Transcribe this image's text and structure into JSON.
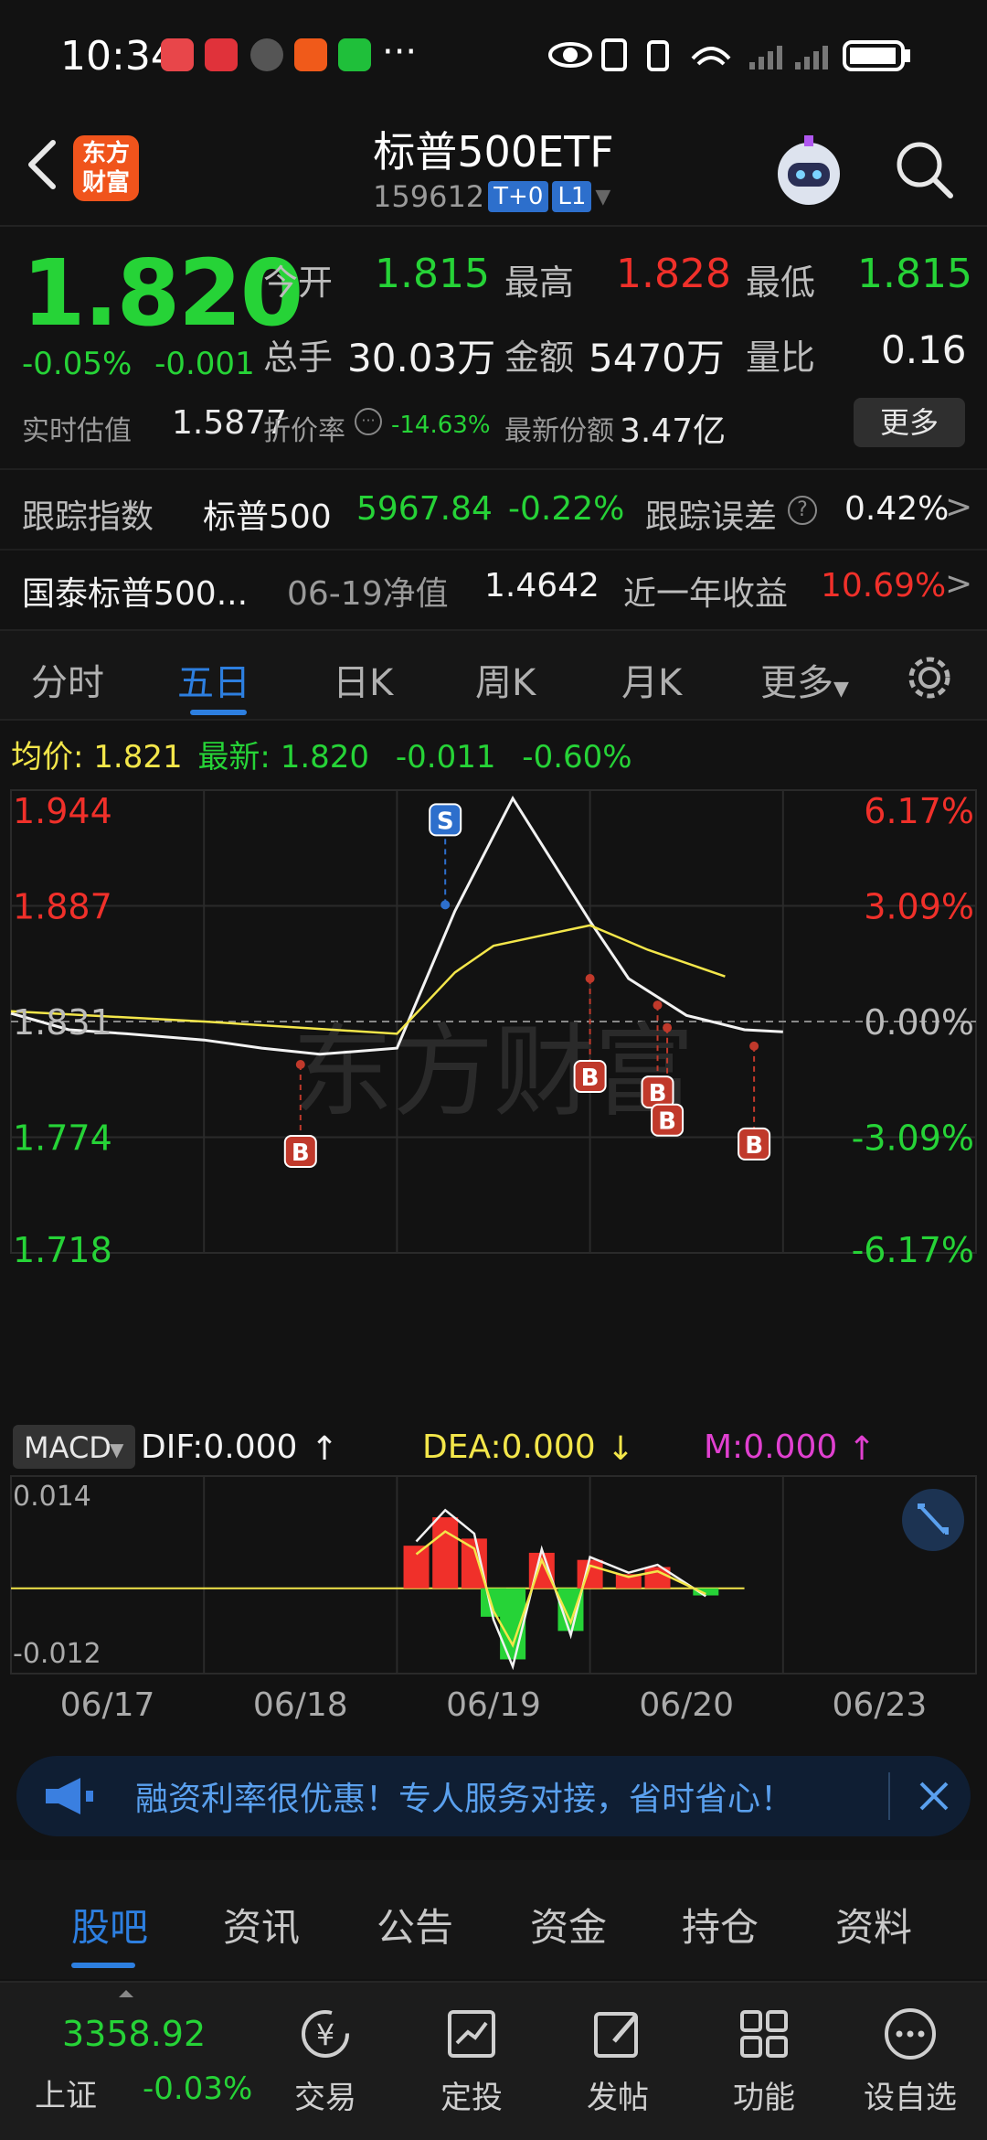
{
  "status": {
    "time": "10:34",
    "more": "···"
  },
  "header": {
    "back": "<",
    "logo": "东方财富",
    "logo_line1": "东方",
    "logo_line2": "财富",
    "name": "标普500ETF",
    "code": "159612",
    "badge1": "T+0",
    "badge2": "L1"
  },
  "quote": {
    "price": "1.820",
    "change_pct": "-0.05%",
    "change_abs": "-0.001",
    "open_label": "今开",
    "open": "1.815",
    "high_label": "最高",
    "high": "1.828",
    "low_label": "最低",
    "low": "1.815",
    "volume_label": "总手",
    "volume": "30.03万",
    "amount_label": "金额",
    "amount": "5470万",
    "ratio_label": "量比",
    "ratio": "0.16",
    "estimate_label": "实时估值",
    "estimate": "1.5877",
    "discount_label": "折价率",
    "discount": "-14.63%",
    "shares_label": "最新份额",
    "shares": "3.47亿",
    "more_label": "更多"
  },
  "tracking": {
    "label": "跟踪指数",
    "index": "标普500",
    "value": "5967.84",
    "pct": "-0.22%",
    "error_label": "跟踪误差",
    "error": "0.42%",
    "arrow": ">"
  },
  "fund": {
    "name": "国泰标普500...",
    "nav_label": "06-19净值",
    "nav": "1.4642",
    "year_label": "近一年收益",
    "year": "10.69%",
    "arrow": ">"
  },
  "tabs": [
    "分时",
    "五日",
    "日K",
    "周K",
    "月K",
    "更多"
  ],
  "info": {
    "avg_label": "均价:",
    "avg": "1.821",
    "latest_label": "最新:",
    "latest": "1.820",
    "chg": "-0.011",
    "pct": "-0.60%"
  },
  "chart_data": {
    "type": "line",
    "title": "",
    "y_labels_left": [
      "1.944",
      "1.887",
      "1.831",
      "1.774",
      "1.718"
    ],
    "y_labels_right": [
      "6.17%",
      "3.09%",
      "0.00%",
      "-3.09%",
      "-6.17%"
    ],
    "ylim": [
      1.718,
      1.944
    ],
    "x_dates": [
      "06/17",
      "06/18",
      "06/19",
      "06/20",
      "06/23"
    ],
    "watermark": "东方财富",
    "series": [
      {
        "name": "",
        "t": [
          0,
          0.3,
          0.6,
          1,
          1.3,
          1.6,
          2,
          2.3,
          2.6,
          3,
          3.2,
          3.5,
          3.8,
          4
        ],
        "values": [
          1.835,
          1.827,
          1.825,
          1.822,
          1.818,
          1.815,
          1.818,
          1.885,
          1.94,
          1.88,
          1.852,
          1.834,
          1.827,
          1.826
        ]
      },
      {
        "name": "",
        "t": [
          0,
          1,
          2,
          2.3,
          2.5,
          2.7,
          3,
          3.3,
          3.7
        ],
        "values": [
          1.836,
          1.831,
          1.825,
          1.855,
          1.868,
          1.872,
          1.878,
          1.866,
          1.853
        ]
      }
    ],
    "markers": [
      {
        "label": "B",
        "t": 1.5,
        "price": 1.81
      },
      {
        "label": "S",
        "t": 2.25,
        "price": 1.888
      },
      {
        "label": "B",
        "t": 3.0,
        "price": 1.852
      },
      {
        "label": "B",
        "t": 3.35,
        "price": 1.839
      },
      {
        "label": "B",
        "t": 3.4,
        "price": 1.828
      },
      {
        "label": "B",
        "t": 3.85,
        "price": 1.819
      }
    ],
    "macd": {
      "selector": "MACD",
      "dif": "DIF:0.000",
      "dea": "DEA:0.000",
      "m": "M:0.000",
      "ymax": "0.014",
      "ymin": "-0.012",
      "range": [
        -0.012,
        0.014
      ],
      "hist_t": [
        2.1,
        2.25,
        2.4,
        2.5,
        2.6,
        2.75,
        2.9,
        3.0,
        3.2,
        3.35,
        3.6
      ],
      "hist_v": [
        0.006,
        0.01,
        0.007,
        -0.004,
        -0.01,
        0.005,
        -0.006,
        0.004,
        0.002,
        0.003,
        -0.001
      ]
    }
  },
  "ad": {
    "text": "融资利率很优惠！专人服务对接，省时省心！"
  },
  "news_tabs": [
    "股吧",
    "资讯",
    "公告",
    "资金",
    "持仓",
    "资料"
  ],
  "bottom_nav": {
    "index_value": "3358.92",
    "index_name": "上证",
    "index_pct": "-0.03%",
    "items": [
      "交易",
      "定投",
      "发帖",
      "功能",
      "设自选"
    ]
  },
  "colors": {
    "up": "#f0302a",
    "down": "#26d337",
    "accent": "#2d7fe0",
    "avg_line": "#f3e64a"
  }
}
